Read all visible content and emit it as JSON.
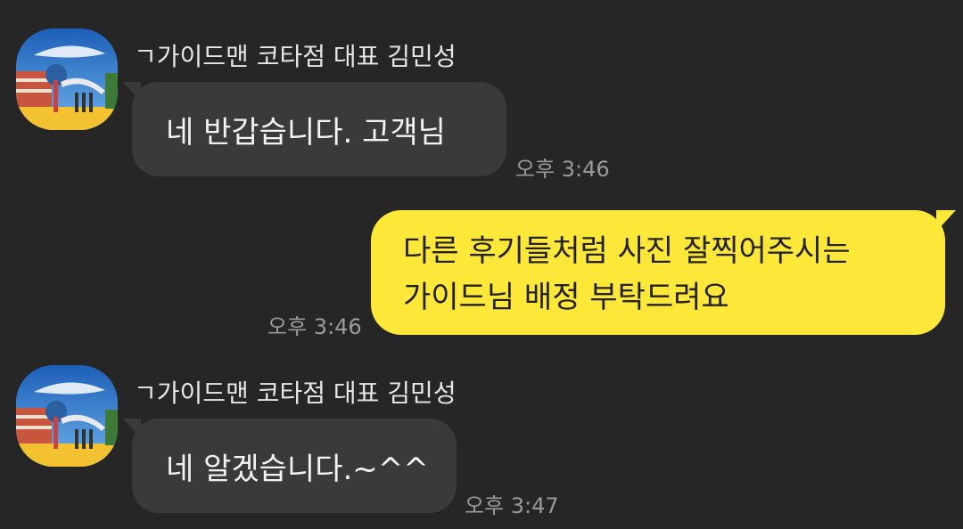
{
  "messages": [
    {
      "direction": "incoming",
      "sender": "ㄱ가이드맨 코타점 대표 김민성",
      "text": "네 반갑습니다. 고객님",
      "time": "오후 3:46"
    },
    {
      "direction": "outgoing",
      "lines": [
        "다른 후기들처럼 사진 잘찍어주시는",
        "가이드님 배정 부탁드려요"
      ],
      "time": "오후 3:46"
    },
    {
      "direction": "incoming",
      "sender": "ㄱ가이드맨 코타점 대표 김민성",
      "text": "네 알겠습니다.~^^",
      "time": "오후 3:47"
    }
  ],
  "colors": {
    "background": "#262626",
    "incoming_bubble": "#3a3a3a",
    "outgoing_bubble": "#fde83a",
    "timestamp": "#9a9a9a"
  },
  "icons": {
    "avatar": "profile-photo-icon"
  }
}
